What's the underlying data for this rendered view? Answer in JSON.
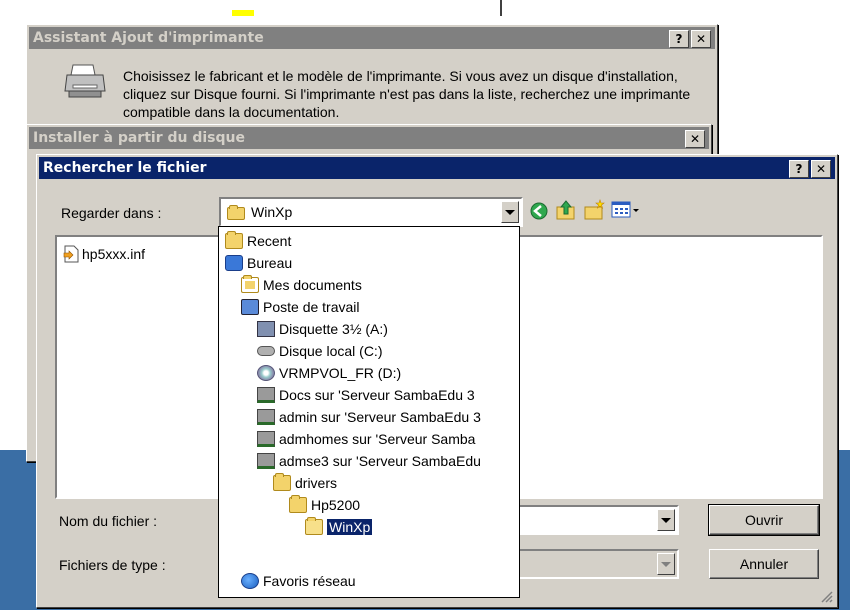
{
  "wizard": {
    "title": "Assistant Ajout d'imprimante",
    "text": "Choisissez le fabricant et le modèle de l'imprimante. Si vous avez un disque d'installation, cliquez sur Disque fourni. Si l'imprimante n'est pas dans la liste, recherchez une imprimante compatible dans la documentation.",
    "help_btn": "?",
    "close_btn": "✕"
  },
  "install": {
    "title": "Installer à partir du disque",
    "close_btn": "✕"
  },
  "dialog": {
    "title": "Rechercher le fichier",
    "help_btn": "?",
    "close_btn": "✕",
    "look_in_label": "Regarder dans :",
    "look_in_value": "WinXp",
    "files": [
      "hp5xxx.inf"
    ],
    "filename_label": "Nom du fichier :",
    "filetype_label": "Fichiers de type :",
    "open_button": "Ouvrir",
    "cancel_button": "Annuler",
    "dropdown": [
      {
        "label": "Recent",
        "icon": "folder-icon"
      },
      {
        "label": "Bureau",
        "icon": "desktop-icon"
      },
      {
        "label": "Mes documents",
        "icon": "my-documents-icon"
      },
      {
        "label": "Poste de travail",
        "icon": "my-computer-icon"
      },
      {
        "label": "Disquette 3½ (A:)",
        "icon": "floppy-drive-icon"
      },
      {
        "label": "Disque local (C:)",
        "icon": "hard-drive-icon"
      },
      {
        "label": "VRMPVOL_FR (D:)",
        "icon": "cd-drive-icon"
      },
      {
        "label": "Docs sur 'Serveur SambaEdu 3",
        "icon": "network-drive-icon"
      },
      {
        "label": "admin sur 'Serveur SambaEdu 3",
        "icon": "network-drive-icon"
      },
      {
        "label": "admhomes sur 'Serveur Samba",
        "icon": "network-drive-icon"
      },
      {
        "label": "admse3 sur 'Serveur SambaEdu",
        "icon": "network-drive-icon"
      },
      {
        "label": "drivers",
        "icon": "folder-icon"
      },
      {
        "label": "Hp5200",
        "icon": "folder-icon"
      },
      {
        "label": "WinXp",
        "icon": "open-folder-icon",
        "selected": true
      },
      {
        "label": "Favoris réseau",
        "icon": "network-places-icon"
      }
    ]
  }
}
